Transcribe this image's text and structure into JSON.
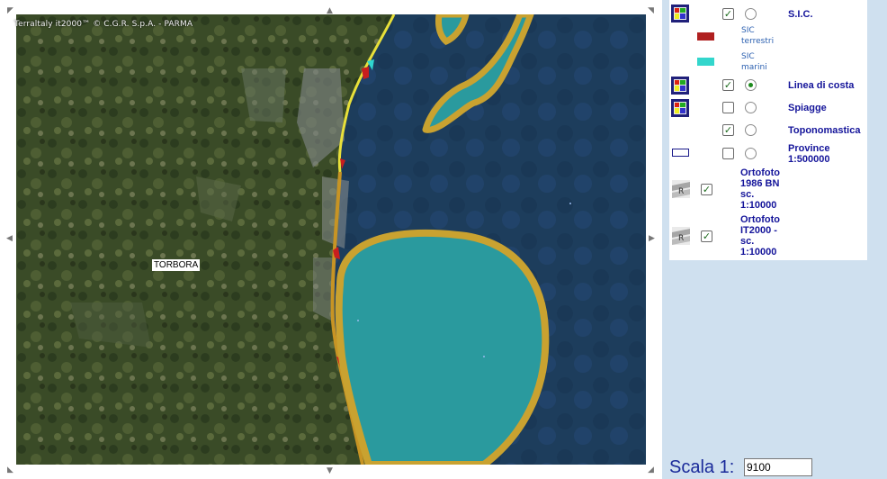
{
  "map": {
    "credit": "Terraltaly it2000™ © C.G.R. S.p.A. - PARMA",
    "place_label": "TORBORA",
    "colors": {
      "land": "#3b4d28",
      "sea": "#1c3f5e",
      "sic_marini": "#2a9a9e",
      "sic_outline": "#c9a230",
      "coast_line": "#e8e03a",
      "sic_terrestri": "#c81e1e"
    }
  },
  "legend": {
    "sic": {
      "label": "S.I.C.",
      "checked": true,
      "active": false,
      "icon": "legend-tool-icon"
    },
    "sic_terrestri": {
      "label_1": "SIC",
      "label_2": "terrestri",
      "color": "#b02020"
    },
    "sic_marini": {
      "label_1": "SIC",
      "label_2": "marini",
      "color": "#33d6cc"
    },
    "linea_di_costa": {
      "label": "Linea di costa",
      "checked": true,
      "active": true,
      "icon": "legend-tool-icon"
    },
    "spiagge": {
      "label": "Spiagge",
      "checked": false,
      "active": false,
      "icon": "legend-tool-icon"
    },
    "toponomastica": {
      "label": "Toponomastica",
      "checked": true,
      "active": false
    },
    "province": {
      "label_1": "Province",
      "label_2": "1:500000",
      "checked": false,
      "active": false,
      "icon": "outline-rectangle-icon"
    },
    "ortofoto_1986": {
      "label_1": "Ortofoto",
      "label_2": "1986 BN",
      "label_3": "sc.",
      "label_4": "1:10000",
      "checked": true,
      "icon": "raster-icon"
    },
    "ortofoto_it2000": {
      "label_1": "Ortofoto",
      "label_2": "IT2000 -",
      "label_3": "sc.",
      "label_4": "1:10000",
      "checked": true,
      "icon": "raster-icon"
    }
  },
  "scale": {
    "label": "Scala 1:",
    "value": "9100"
  }
}
